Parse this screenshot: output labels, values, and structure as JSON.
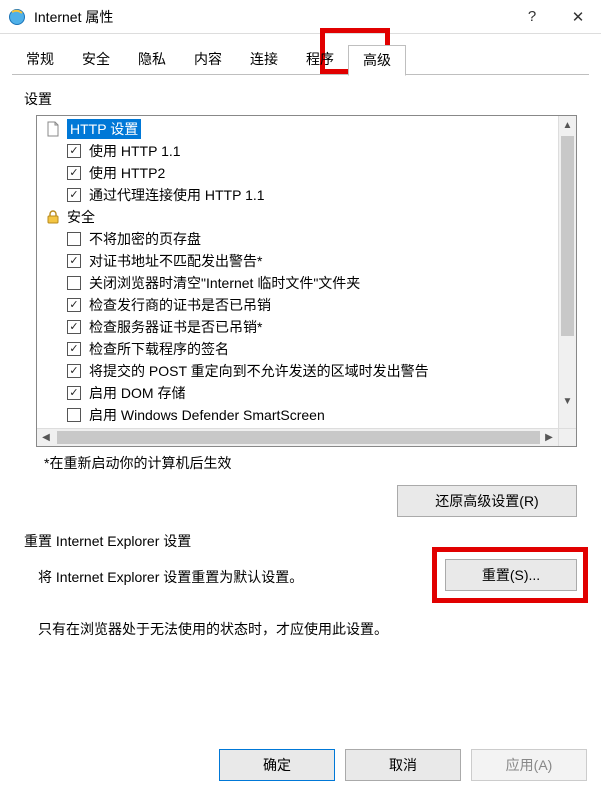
{
  "titlebar": {
    "title": "Internet 属性",
    "help_label": "?",
    "close_label": "✕"
  },
  "tabs": [
    {
      "label": "常规",
      "active": false
    },
    {
      "label": "安全",
      "active": false
    },
    {
      "label": "隐私",
      "active": false
    },
    {
      "label": "内容",
      "active": false
    },
    {
      "label": "连接",
      "active": false
    },
    {
      "label": "程序",
      "active": false
    },
    {
      "label": "高级",
      "active": true
    }
  ],
  "settings_label": "设置",
  "tree": [
    {
      "type": "cat",
      "icon": "page",
      "label": "HTTP 设置",
      "selected": true
    },
    {
      "type": "item",
      "checked": true,
      "label": "使用 HTTP 1.1"
    },
    {
      "type": "item",
      "checked": true,
      "label": "使用 HTTP2"
    },
    {
      "type": "item",
      "checked": true,
      "label": "通过代理连接使用 HTTP 1.1"
    },
    {
      "type": "cat",
      "icon": "lock",
      "label": "安全"
    },
    {
      "type": "item",
      "checked": false,
      "label": "不将加密的页存盘"
    },
    {
      "type": "item",
      "checked": true,
      "label": "对证书地址不匹配发出警告*"
    },
    {
      "type": "item",
      "checked": false,
      "label": "关闭浏览器时清空\"Internet 临时文件\"文件夹"
    },
    {
      "type": "item",
      "checked": true,
      "label": "检查发行商的证书是否已吊销"
    },
    {
      "type": "item",
      "checked": true,
      "label": "检查服务器证书是否已吊销*"
    },
    {
      "type": "item",
      "checked": true,
      "label": "检查所下载程序的签名"
    },
    {
      "type": "item",
      "checked": true,
      "label": "将提交的 POST 重定向到不允许发送的区域时发出警告"
    },
    {
      "type": "item",
      "checked": true,
      "label": "启用 DOM 存储"
    },
    {
      "type": "item",
      "checked": false,
      "label": "启用 Windows Defender SmartScreen"
    }
  ],
  "restart_note": "*在重新启动你的计算机后生效",
  "restore_button": "还原高级设置(R)",
  "reset_section_label": "重置 Internet Explorer 设置",
  "reset_text": "将 Internet Explorer 设置重置为默认设置。",
  "reset_button": "重置(S)...",
  "reset_note": "只有在浏览器处于无法使用的状态时，才应使用此设置。",
  "buttons": {
    "ok": "确定",
    "cancel": "取消",
    "apply": "应用(A)"
  }
}
